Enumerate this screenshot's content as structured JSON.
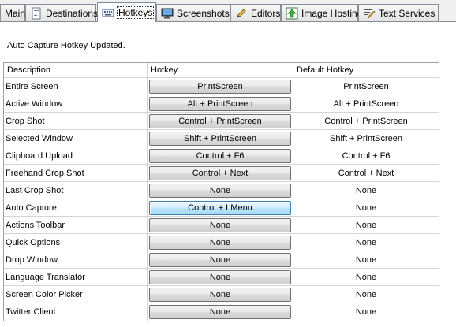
{
  "tabs": [
    {
      "label": "Main",
      "icon": "none"
    },
    {
      "label": "Destinations",
      "icon": "document-icon"
    },
    {
      "label": "Hotkeys",
      "icon": "keyboard-icon",
      "active": true
    },
    {
      "label": "Screenshots",
      "icon": "monitor-icon"
    },
    {
      "label": "Editors",
      "icon": "pencil-icon"
    },
    {
      "label": "Image Hosting",
      "icon": "upload-icon"
    },
    {
      "label": "Text Services",
      "icon": "text-edit-icon"
    }
  ],
  "status_message": "Auto Capture Hotkey Updated.",
  "grid": {
    "columns": [
      "Description",
      "Hotkey",
      "Default Hotkey"
    ],
    "rows": [
      {
        "description": "Entire Screen",
        "hotkey": "PrintScreen",
        "default": "PrintScreen"
      },
      {
        "description": "Active Window",
        "hotkey": "Alt + PrintScreen",
        "default": "Alt + PrintScreen"
      },
      {
        "description": "Crop Shot",
        "hotkey": "Control + PrintScreen",
        "default": "Control + PrintScreen"
      },
      {
        "description": "Selected Window",
        "hotkey": "Shift + PrintScreen",
        "default": "Shift + PrintScreen"
      },
      {
        "description": "Clipboard Upload",
        "hotkey": "Control + F6",
        "default": "Control + F6"
      },
      {
        "description": "Freehand Crop Shot",
        "hotkey": "Control + Next",
        "default": "Control + Next"
      },
      {
        "description": "Last Crop Shot",
        "hotkey": "None",
        "default": "None"
      },
      {
        "description": "Auto Capture",
        "hotkey": "Control + LMenu",
        "default": "None",
        "focused": true
      },
      {
        "description": "Actions Toolbar",
        "hotkey": "None",
        "default": "None"
      },
      {
        "description": "Quick Options",
        "hotkey": "None",
        "default": "None"
      },
      {
        "description": "Drop Window",
        "hotkey": "None",
        "default": "None"
      },
      {
        "description": "Language Translator",
        "hotkey": "None",
        "default": "None"
      },
      {
        "description": "Screen Color Picker",
        "hotkey": "None",
        "default": "None"
      },
      {
        "description": "Twitter Client",
        "hotkey": "None",
        "default": "None"
      }
    ]
  }
}
